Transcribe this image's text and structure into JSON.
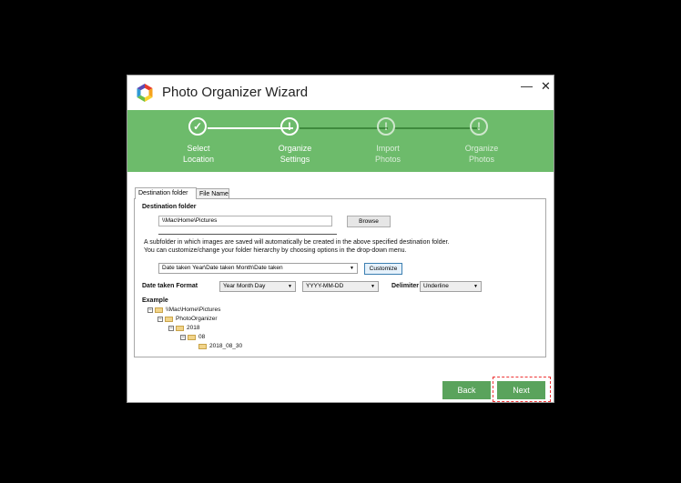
{
  "window": {
    "title": "Photo Organizer Wizard",
    "minimize_label": "—",
    "close_label": "✕"
  },
  "steps": [
    {
      "label": "Select\nLocation",
      "state": "done",
      "symbol": "✓"
    },
    {
      "label": "Organize\nSettings",
      "state": "current",
      "symbol": "!"
    },
    {
      "label": "Import\nPhotos",
      "state": "pending",
      "symbol": "!"
    },
    {
      "label": "Organize\nPhotos",
      "state": "pending",
      "symbol": "!"
    }
  ],
  "tabs": [
    "Destination folder",
    "File Name"
  ],
  "destination": {
    "label": "Destination folder",
    "path": "\\\\Mac\\Home\\Pictures",
    "browse_label": "Browse"
  },
  "info_text": [
    "A subfolder in which images are saved will automatically be created in the above specified destination folder.",
    "You can customize/change your folder hierarchy by choosing options in the drop-down menu."
  ],
  "hierarchy": {
    "value": "Date taken Year\\Date taken Month\\Date taken",
    "customize_label": "Customize"
  },
  "format": {
    "label": "Date taken Format",
    "option1": "Year Month Day",
    "option2": "YYYY-MM-DD",
    "delimiter_label": "Delimiter",
    "delimiter_value": "Underline"
  },
  "example": {
    "label": "Example",
    "tree": [
      "\\\\Mac\\Home\\Pictures",
      "PhotoOrganizer",
      "2018",
      "08",
      "2018_08_30"
    ]
  },
  "footer": {
    "back_label": "Back",
    "next_label": "Next"
  },
  "colors": {
    "accent": "#6dbb6b",
    "button": "#5aa35c",
    "highlight": "#e33333"
  }
}
